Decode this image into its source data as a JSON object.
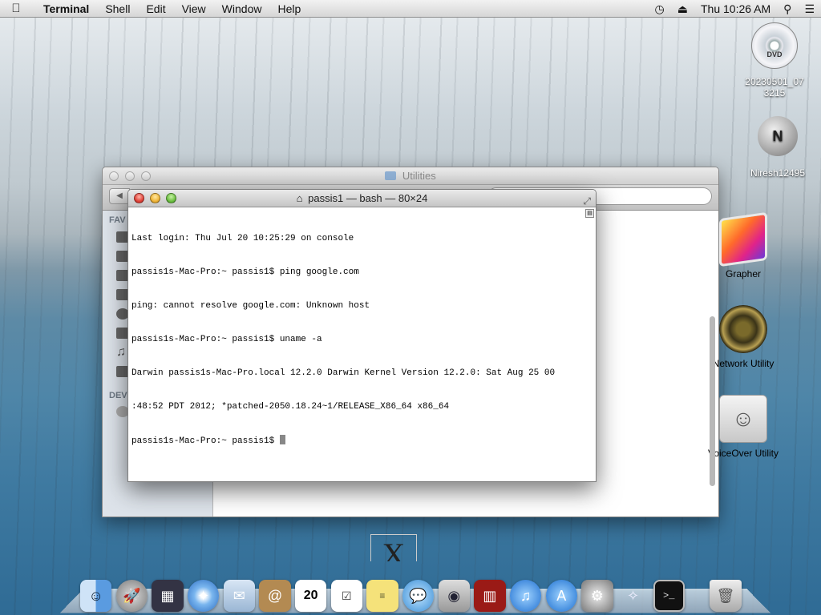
{
  "menubar": {
    "apple": "",
    "app_name": "Terminal",
    "menus": [
      "Shell",
      "Edit",
      "View",
      "Window",
      "Help"
    ],
    "time_machine_icon": "◷",
    "eject_icon": "⏏",
    "clock": "Thu 10:26 AM",
    "spotlight_icon": "⚲",
    "list_icon": "☰"
  },
  "desktop": {
    "dvd_label_line1": "20230501_07",
    "dvd_label_line2": "3215",
    "dvd_icon_text": "DVD",
    "disk_label": "Niresh12495",
    "disk_icon_text": "N"
  },
  "finder": {
    "title": "Utilities",
    "sidebar_heading_favorites": "FAV",
    "sidebar_heading_devices": "DEV",
    "items": [
      {
        "label": "Grapher"
      },
      {
        "label": "Network Utility"
      },
      {
        "label": "VoiceOver Utility"
      }
    ],
    "x_tile": "X"
  },
  "terminal": {
    "title": "passis1 — bash — 80×24",
    "lines": [
      "Last login: Thu Jul 20 10:25:29 on console",
      "passis1s-Mac-Pro:~ passis1$ ping google.com",
      "ping: cannot resolve google.com: Unknown host",
      "passis1s-Mac-Pro:~ passis1$ uname -a",
      "Darwin passis1s-Mac-Pro.local 12.2.0 Darwin Kernel Version 12.2.0: Sat Aug 25 00",
      ":48:52 PDT 2012; *patched-2050.18.24~1/RELEASE_X86_64 x86_64",
      "passis1s-Mac-Pro:~ passis1$ "
    ]
  },
  "dock": {
    "calendar_day": "20"
  },
  "colors": {
    "close": "#e0443a",
    "minimize": "#efb53a",
    "zoom": "#6ec043"
  }
}
